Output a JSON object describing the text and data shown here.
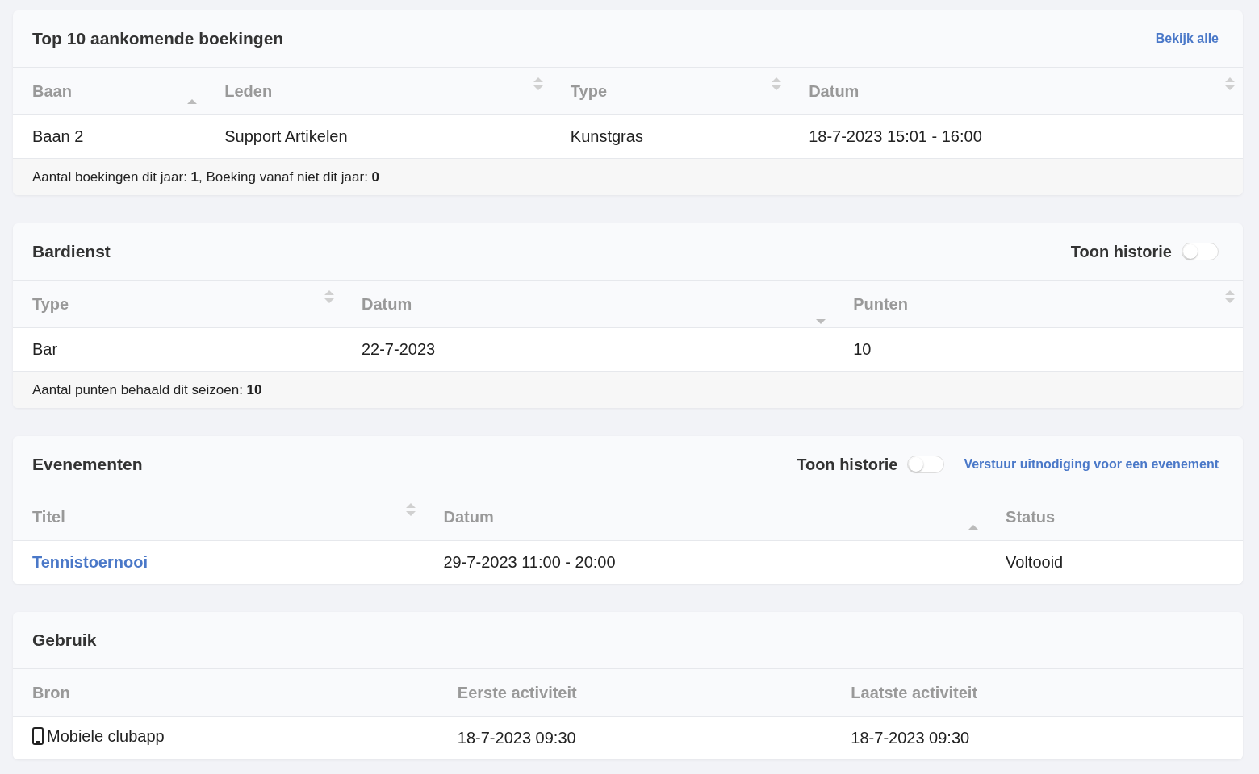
{
  "cards": [
    {
      "title": "Top 10 aankomende boekingen",
      "action": "Bekijk alle",
      "columns": [
        {
          "label": "Baan",
          "sortable": true,
          "sorted": true,
          "descending": false
        },
        {
          "label": "Leden",
          "sortable": true,
          "sorted": false
        },
        {
          "label": "Type",
          "sortable": true,
          "sorted": false
        },
        {
          "label": "Datum",
          "sortable": true,
          "sorted": false
        }
      ],
      "rows": [
        [
          {
            "kind": "text",
            "text": "Baan 2"
          },
          {
            "kind": "text",
            "text": "Support Artikelen"
          },
          {
            "kind": "text",
            "text": "Kunstgras"
          },
          {
            "kind": "text",
            "text": "18-7-2023 15:01 - 16:00"
          }
        ]
      ],
      "footer": "Aantal boekingen dit jaar: **1**, Boeking vanaf niet dit jaar: **0**"
    },
    {
      "title": "Bardienst",
      "toggle": {
        "label": "Toon historie",
        "on": false
      },
      "columns": [
        {
          "label": "Type",
          "sortable": true,
          "sorted": false
        },
        {
          "label": "Datum",
          "sortable": true,
          "sorted": true,
          "descending": true
        },
        {
          "label": "Punten",
          "sortable": true,
          "sorted": false
        }
      ],
      "rows": [
        [
          {
            "kind": "text",
            "text": "Bar"
          },
          {
            "kind": "text",
            "text": "22-7-2023"
          },
          {
            "kind": "text",
            "text": "10"
          }
        ]
      ],
      "footer": "Aantal punten behaald dit seizoen: **10**"
    },
    {
      "title": "Evenementen",
      "toggle": {
        "label": "Toon historie",
        "on": false
      },
      "action": "Verstuur uitnodiging voor een evenement",
      "columns": [
        {
          "label": "Titel",
          "sortable": true,
          "sorted": false
        },
        {
          "label": "Datum",
          "sortable": true,
          "sorted": true,
          "descending": false
        },
        {
          "label": "Status",
          "sortable": false
        }
      ],
      "rows": [
        [
          {
            "kind": "link",
            "text": "Tennistoernooi"
          },
          {
            "kind": "text",
            "text": "29-7-2023 11:00 - 20:00"
          },
          {
            "kind": "text",
            "text": "Voltooid"
          }
        ]
      ]
    },
    {
      "title": "Gebruik",
      "columns": [
        {
          "label": "Bron",
          "sortable": false
        },
        {
          "label": "Eerste activiteit",
          "sortable": false
        },
        {
          "label": "Laatste activiteit",
          "sortable": false
        }
      ],
      "rows": [
        [
          {
            "kind": "device",
            "text": "Mobiele clubapp"
          },
          {
            "kind": "text",
            "text": "18-7-2023 09:30"
          },
          {
            "kind": "text",
            "text": "18-7-2023 09:30"
          }
        ]
      ]
    }
  ]
}
